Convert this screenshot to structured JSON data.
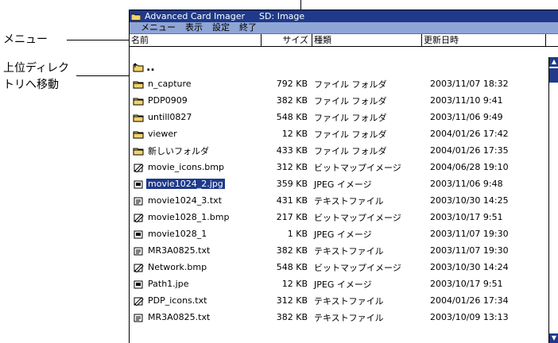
{
  "annotations": {
    "menu": "メニュー",
    "parent_dir_line1": "上位ディレク",
    "parent_dir_line2": "トリへ移動"
  },
  "window": {
    "app_title": "Advanced Card Imager",
    "location": "SD: Image",
    "menu": [
      "メニュー",
      "表示",
      "設定",
      "終了"
    ],
    "columns": [
      "名前",
      "サイズ",
      "種類",
      "更新日時"
    ],
    "parent_dir": ".."
  },
  "files": [
    {
      "name": "n_capture",
      "size": "792 KB",
      "type": "ファイル フォルダ",
      "date": "2003/11/07 18:32",
      "icon": "folder-icon"
    },
    {
      "name": "PDP0909",
      "size": "382 KB",
      "type": "ファイル フォルダ",
      "date": "2003/11/10 9:41",
      "icon": "folder-icon"
    },
    {
      "name": "untill0827",
      "size": "548 KB",
      "type": "ファイル フォルダ",
      "date": "2003/11/06 9:49",
      "icon": "folder-icon"
    },
    {
      "name": "viewer",
      "size": "12 KB",
      "type": "ファイル フォルダ",
      "date": "2004/01/26 17:42",
      "icon": "folder-icon"
    },
    {
      "name": "新しいフォルダ",
      "size": "433 KB",
      "type": "ファイル フォルダ",
      "date": "2004/01/26 17:35",
      "icon": "folder-icon"
    },
    {
      "name": "movie_icons.bmp",
      "size": "312 KB",
      "type": "ビットマップイメージ",
      "date": "2004/06/28 19:10",
      "icon": "bitmap-file-icon"
    },
    {
      "name": "movie1024_2.jpg",
      "size": "359 KB",
      "type": "JPEG イメージ",
      "date": "2003/11/06 9:48",
      "icon": "jpeg-file-icon",
      "selected": true
    },
    {
      "name": "movie1024_3.txt",
      "size": "431 KB",
      "type": "テキストファイル",
      "date": "2003/10/30 14:25",
      "icon": "text-file-icon"
    },
    {
      "name": "movie1028_1.bmp",
      "size": "217 KB",
      "type": "ビットマップイメージ",
      "date": "2003/10/17 9:51",
      "icon": "bitmap-file-icon"
    },
    {
      "name": "movie1028_1",
      "size": "1 KB",
      "type": "JPEG イメージ",
      "date": "2003/11/07 19:30",
      "icon": "jpeg-file-icon"
    },
    {
      "name": "MR3A0825.txt",
      "size": "382 KB",
      "type": "テキストファイル",
      "date": "2003/11/07 19:30",
      "icon": "text-file-icon"
    },
    {
      "name": "Network.bmp",
      "size": "548 KB",
      "type": "ビットマップイメージ",
      "date": "2003/10/30 14:24",
      "icon": "bitmap-file-icon"
    },
    {
      "name": "Path1.jpe",
      "size": "12 KB",
      "type": "JPEG イメージ",
      "date": "2003/10/17 9:51",
      "icon": "jpeg-file-icon"
    },
    {
      "name": "PDP_icons.txt",
      "size": "312 KB",
      "type": "テキストファイル",
      "date": "2004/01/26 17:34",
      "icon": "bitmap-file-icon"
    },
    {
      "name": "MR3A0825.txt",
      "size": "382 KB",
      "type": "テキストファイル",
      "date": "2003/10/09 13:13",
      "icon": "text-file-icon"
    }
  ]
}
